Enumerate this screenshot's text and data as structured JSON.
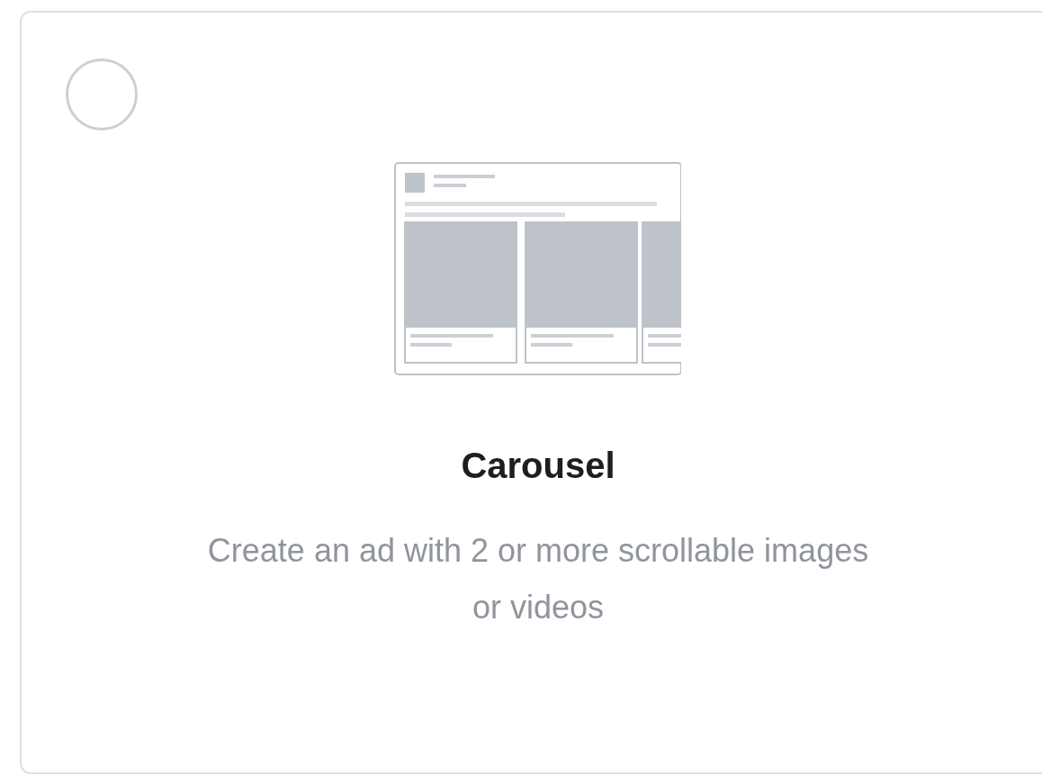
{
  "option": {
    "selected": false,
    "title": "Carousel",
    "description": "Create an ad with 2 or more scrollable images or videos"
  }
}
